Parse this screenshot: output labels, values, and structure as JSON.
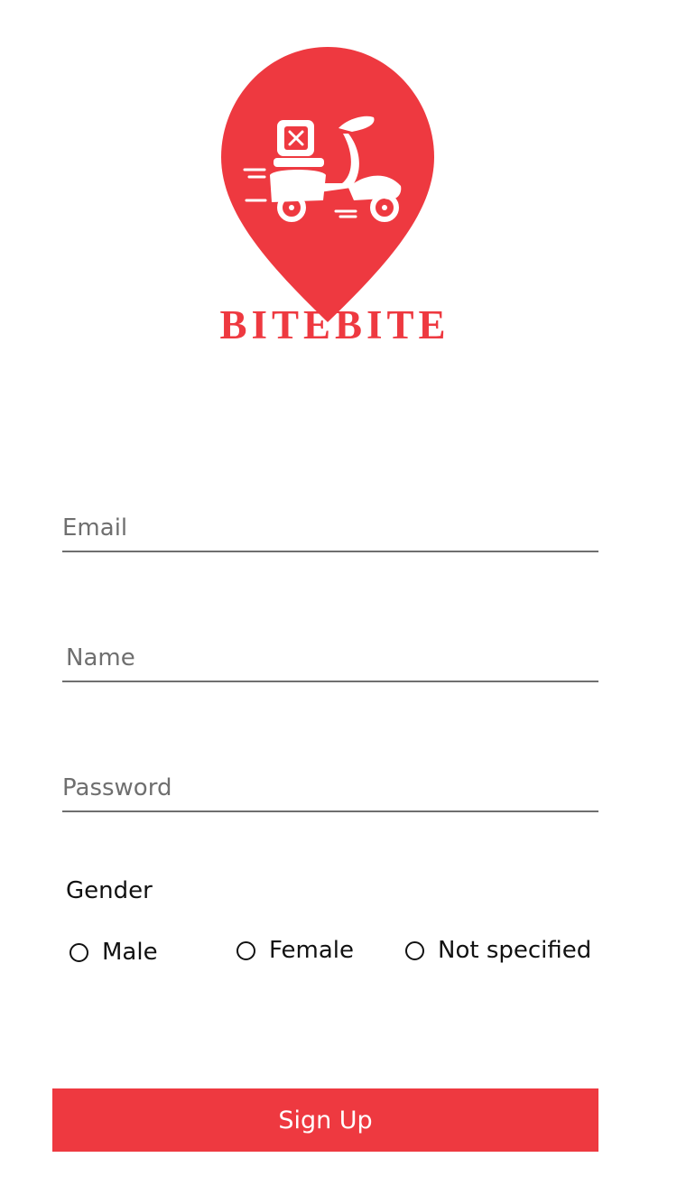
{
  "brand": {
    "logo_text": "BITEBITE",
    "color": "#ee3940"
  },
  "form": {
    "email_placeholder": "Email",
    "name_placeholder": "Name",
    "password_placeholder": "Password",
    "gender_label": "Gender",
    "gender_options": [
      "Male",
      "Female",
      "Not specified"
    ],
    "submit_label": "Sign Up"
  },
  "icons": {
    "logo": "location-pin-scooter-icon",
    "radio": "radio-unselected-icon"
  }
}
